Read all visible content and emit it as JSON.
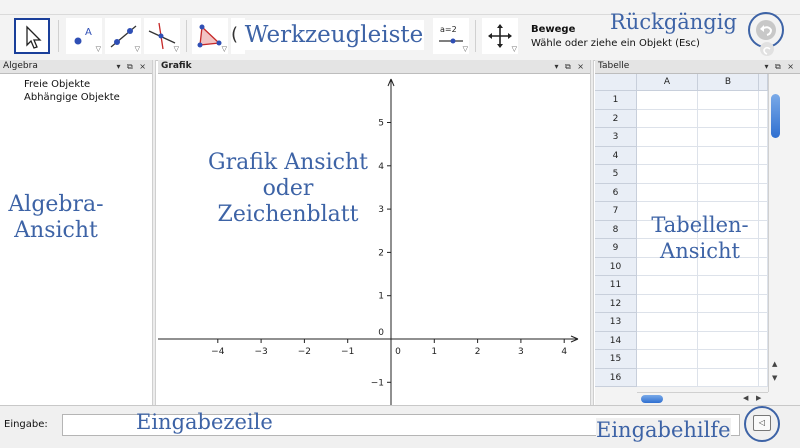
{
  "toolbar": {
    "tool_name": "Bewege",
    "tool_help": "Wähle oder ziehe ein Objekt (Esc)",
    "slider_icon_label": "a=2",
    "partial_label": "("
  },
  "panels": {
    "algebra": {
      "title": "Algebra",
      "items": [
        "Freie Objekte",
        "Abhängige Objekte"
      ]
    },
    "graphics": {
      "title": "Grafik",
      "x_ticks": [
        "−4",
        "−3",
        "−2",
        "−1",
        "0",
        "1",
        "2",
        "3",
        "4"
      ],
      "y_ticks": [
        "5",
        "4",
        "3",
        "2",
        "1",
        "0",
        "−1"
      ]
    },
    "spreadsheet": {
      "title": "Tabelle",
      "columns": [
        "A",
        "B"
      ],
      "rows": [
        "1",
        "2",
        "3",
        "4",
        "5",
        "6",
        "7",
        "8",
        "9",
        "10",
        "11",
        "12",
        "13",
        "14",
        "15",
        "16"
      ]
    },
    "panel_controls": "▾ ⧉ ×"
  },
  "input_bar": {
    "label": "Eingabe:",
    "value": ""
  },
  "annotations": {
    "toolbar": "Werkzeugleiste",
    "undo": "Rückgängig",
    "algebra_line1": "Algebra-",
    "algebra_line2": "Ansicht",
    "graphics_line1": "Grafik Ansicht",
    "graphics_line2": "oder",
    "graphics_line3": "Zeichenblatt",
    "table_line1": "Tabellen-",
    "table_line2": "Ansicht",
    "input_line": "Eingabezeile",
    "input_help": "Eingabehilfe"
  },
  "colors": {
    "annotation_text": "#3d63a6",
    "selected_tool_border": "#1a3f9a",
    "annotation_circle": "#3d63a6"
  },
  "icons": [
    "move-arrow-icon",
    "point-icon",
    "line-icon",
    "perpendicular-icon",
    "polygon-icon",
    "slider-icon",
    "move-view-icon",
    "undo-icon",
    "redo-icon",
    "input-help-icon"
  ]
}
